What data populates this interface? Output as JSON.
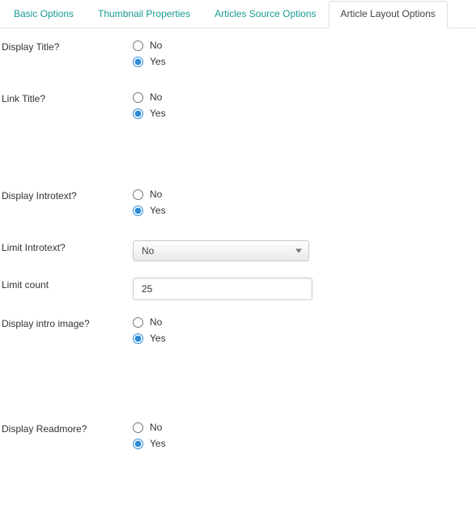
{
  "tabs": [
    {
      "label": "Basic Options",
      "active": false
    },
    {
      "label": "Thumbnail Properties",
      "active": false
    },
    {
      "label": "Articles Source Options",
      "active": false
    },
    {
      "label": "Article Layout Options",
      "active": true
    }
  ],
  "labels": {
    "no": "No",
    "yes": "Yes"
  },
  "fields": {
    "display_title": {
      "label": "Display Title?",
      "value": "yes"
    },
    "link_title": {
      "label": "Link Title?",
      "value": "yes"
    },
    "display_introtext": {
      "label": "Display Introtext?",
      "value": "yes"
    },
    "limit_introtext": {
      "label": "Limit Introtext?",
      "selected": "No"
    },
    "limit_count": {
      "label": "Limit count",
      "value": "25"
    },
    "display_intro_image": {
      "label": "Display intro image?",
      "value": "yes"
    },
    "display_readmore": {
      "label": "Display Readmore?",
      "value": "yes"
    }
  }
}
